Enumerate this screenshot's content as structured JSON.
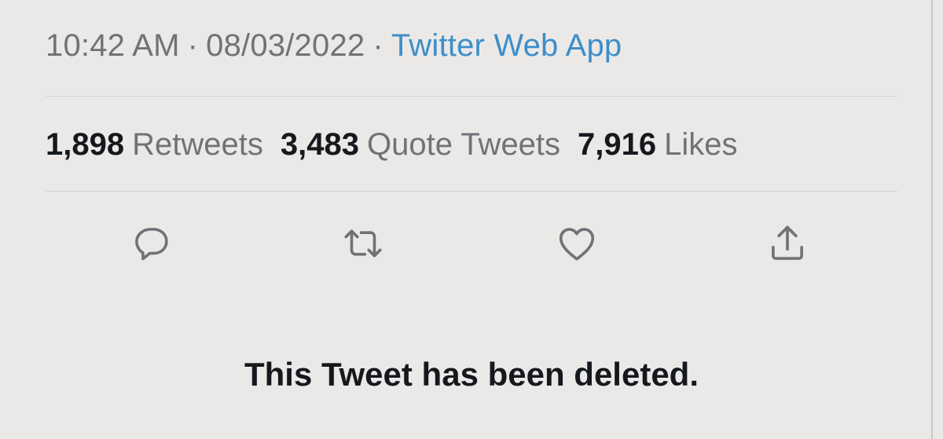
{
  "tweet_meta": {
    "time": "10:42 AM",
    "separator": "·",
    "date": "08/03/2022",
    "source": "Twitter Web App"
  },
  "stats": {
    "retweets": {
      "count": "1,898",
      "label": "Retweets"
    },
    "quote_tweets": {
      "count": "3,483",
      "label": "Quote Tweets"
    },
    "likes": {
      "count": "7,916",
      "label": "Likes"
    }
  },
  "actions": {
    "reply_icon": "reply-icon",
    "retweet_icon": "retweet-icon",
    "like_icon": "heart-icon",
    "share_icon": "share-icon"
  },
  "colors": {
    "background": "#ebe9e7",
    "secondary_text": "#6f7377",
    "primary_text": "#15191e",
    "link": "#3d8ec9",
    "icon": "#6f7377"
  },
  "deleted_message": "This Tweet has been deleted."
}
